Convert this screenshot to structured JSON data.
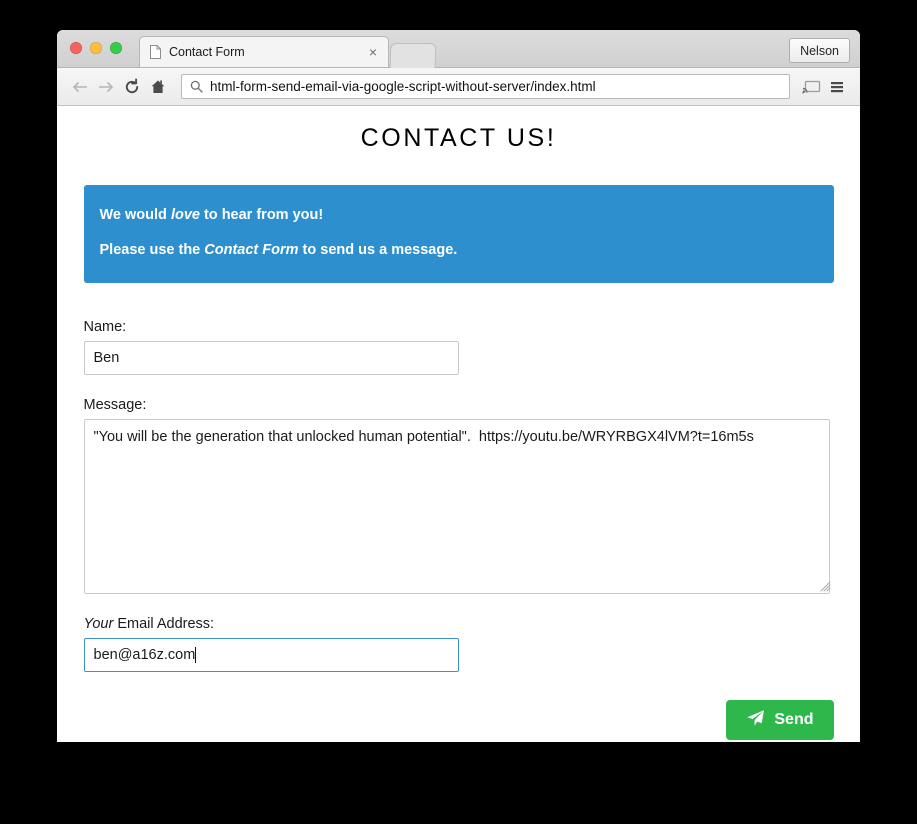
{
  "browser": {
    "window_controls": [
      "close",
      "minimize",
      "maximize"
    ],
    "tab": {
      "title": "Contact Form",
      "close_label": "×",
      "favicon": "document-icon"
    },
    "new_tab_label": "",
    "profile_label": "Nelson",
    "nav": {
      "back": "back-arrow-icon",
      "forward": "forward-arrow-icon",
      "reload": "reload-icon",
      "home": "home-icon"
    },
    "omnibox": {
      "icon": "search-icon",
      "url": "html-form-send-email-via-google-script-without-server/index.html",
      "placeholder": "Search Google or type URL"
    },
    "right_icons": [
      "cast-icon",
      "menu-icon"
    ]
  },
  "page": {
    "title": "CONTACT US!",
    "alert": {
      "line1_part1": "We would ",
      "line1_emphasis": "love",
      "line1_part2": " to hear from you!",
      "line2_part1": "Please use the ",
      "line2_emphasis": "Contact Form",
      "line2_part2": " to send us a message.",
      "background_color": "#2e8fcf"
    },
    "form": {
      "name": {
        "label": "Name:",
        "value": "Ben",
        "placeholder": ""
      },
      "message": {
        "label": "Message:",
        "value": "\"You will be the generation that unlocked human potential\".  https://youtu.be/WRYRBGX4lVM?t=16m5s",
        "placeholder": ""
      },
      "email": {
        "label_emphasis": "Your",
        "label_rest": " Email Address:",
        "value": "ben@a16z.com",
        "placeholder": "",
        "focused": true,
        "focus_color": "#3b92cc"
      },
      "submit": {
        "label": "Send",
        "icon": "paper-plane-icon",
        "background_color": "#2eb84c"
      }
    }
  }
}
